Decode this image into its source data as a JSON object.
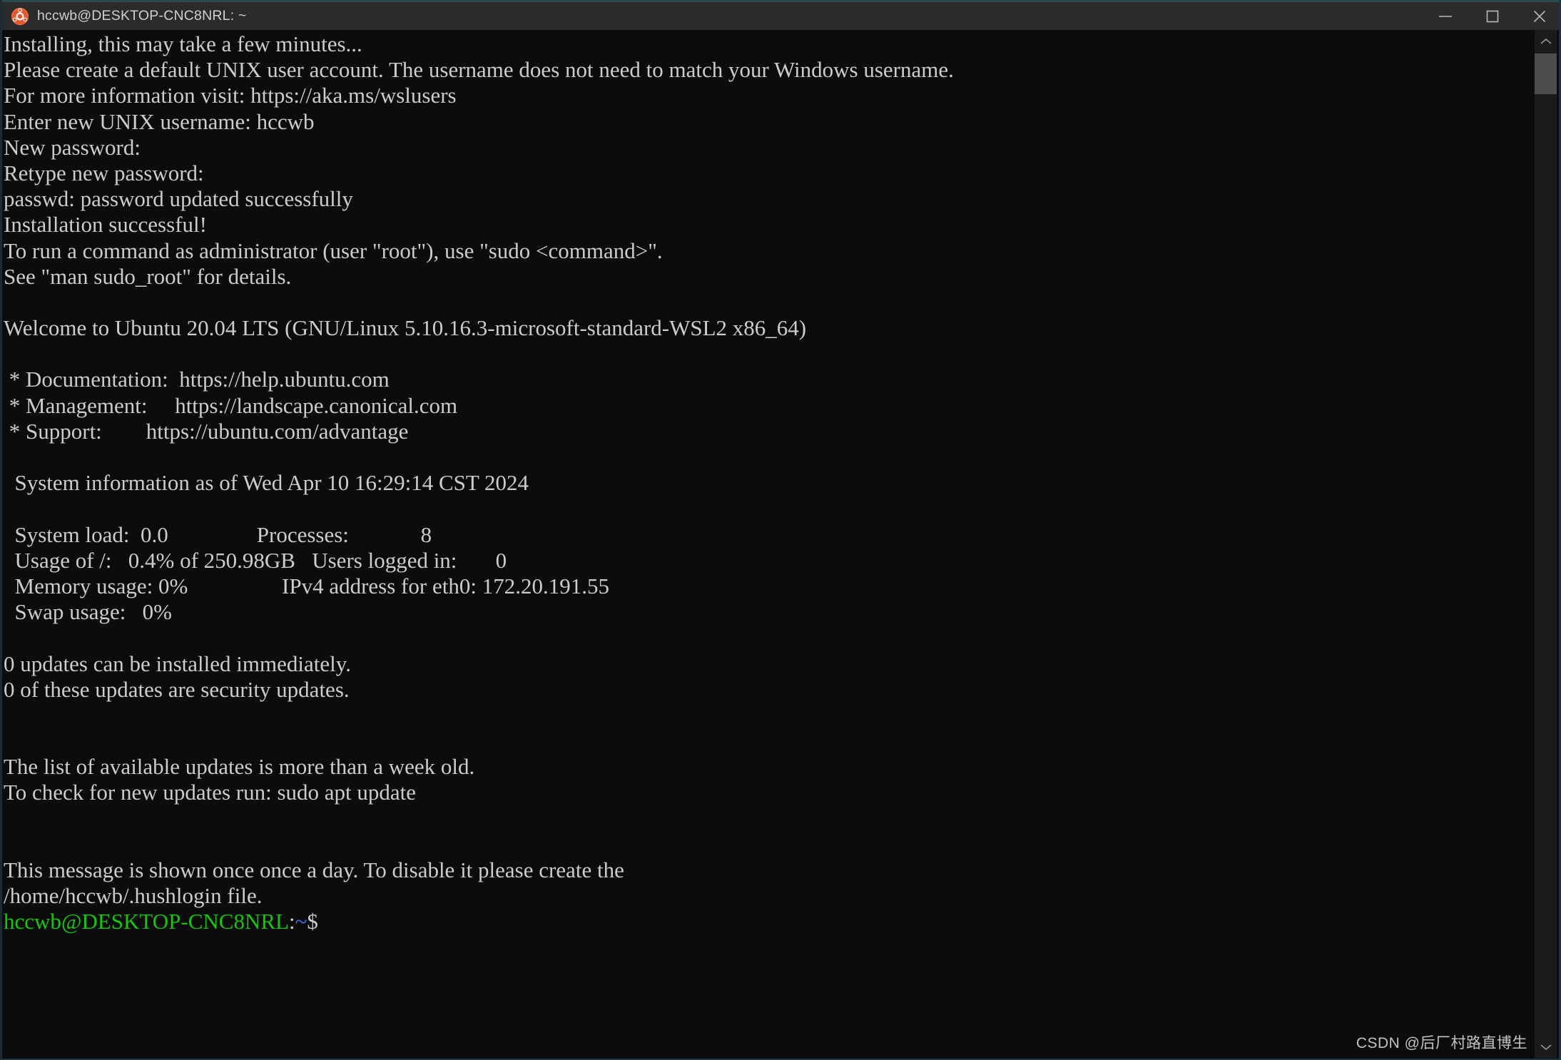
{
  "window": {
    "title": "hccwb@DESKTOP-CNC8NRL: ~",
    "app_icon": "ubuntu-logo-icon",
    "controls": {
      "minimize": "minimize-icon",
      "maximize": "maximize-icon",
      "close": "close-icon"
    },
    "accent_color": "#2c4950",
    "titlebar_color": "#2b2b2b",
    "terminal_background": "#0c0c0c",
    "terminal_foreground": "#cccccc"
  },
  "scrollbar": {
    "up_arrow": "chevron-up-icon",
    "down_arrow": "chevron-down-icon",
    "thumb_color": "#4d4d4d",
    "track_color": "#1b1b1b"
  },
  "terminal": {
    "lines": [
      "Installing, this may take a few minutes...",
      "Please create a default UNIX user account. The username does not need to match your Windows username.",
      "For more information visit: https://aka.ms/wslusers",
      "Enter new UNIX username: hccwb",
      "New password:",
      "Retype new password:",
      "passwd: password updated successfully",
      "Installation successful!",
      "To run a command as administrator (user \"root\"), use \"sudo <command>\".",
      "See \"man sudo_root\" for details.",
      "",
      "Welcome to Ubuntu 20.04 LTS (GNU/Linux 5.10.16.3-microsoft-standard-WSL2 x86_64)",
      "",
      " * Documentation:  https://help.ubuntu.com",
      " * Management:     https://landscape.canonical.com",
      " * Support:        https://ubuntu.com/advantage",
      "",
      "  System information as of Wed Apr 10 16:29:14 CST 2024",
      "",
      "  System load:  0.0                Processes:             8",
      "  Usage of /:   0.4% of 250.98GB   Users logged in:       0",
      "  Memory usage: 0%                 IPv4 address for eth0: 172.20.191.55",
      "  Swap usage:   0%",
      "",
      "0 updates can be installed immediately.",
      "0 of these updates are security updates.",
      "",
      "",
      "The list of available updates is more than a week old.",
      "To check for new updates run: sudo apt update",
      "",
      "",
      "This message is shown once once a day. To disable it please create the",
      "/home/hccwb/.hushlogin file."
    ],
    "prompt": {
      "user_host": "hccwb@DESKTOP-CNC8NRL",
      "separator": ":",
      "path": "~",
      "symbol": "$",
      "user_host_color": "#16c60c",
      "path_color": "#3b78ff",
      "symbol_color": "#cccccc"
    },
    "system_info": {
      "header": "System information as of Wed Apr 10 16:29:14 CST 2024",
      "left": [
        {
          "label": "System load:",
          "value": "0.0"
        },
        {
          "label": "Usage of /:",
          "value": "0.4% of 250.98GB"
        },
        {
          "label": "Memory usage:",
          "value": "0%"
        },
        {
          "label": "Swap usage:",
          "value": "0%"
        }
      ],
      "right": [
        {
          "label": "Processes:",
          "value": "8"
        },
        {
          "label": "Users logged in:",
          "value": "0"
        },
        {
          "label": "IPv4 address for eth0:",
          "value": "172.20.191.55"
        }
      ]
    },
    "links": [
      {
        "label": " * Documentation:",
        "url": "https://help.ubuntu.com"
      },
      {
        "label": " * Management:",
        "url": "https://landscape.canonical.com"
      },
      {
        "label": " * Support:",
        "url": "https://ubuntu.com/advantage"
      }
    ],
    "os_banner": "Welcome to Ubuntu 20.04 LTS (GNU/Linux 5.10.16.3-microsoft-standard-WSL2 x86_64)"
  },
  "watermark": {
    "text": "CSDN @后厂村路直博生"
  }
}
